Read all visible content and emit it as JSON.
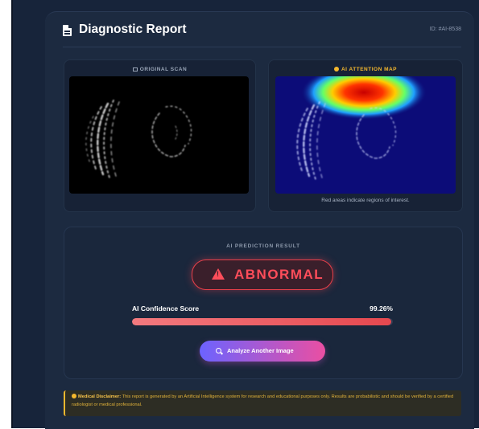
{
  "header": {
    "title": "Diagnostic Report",
    "report_id": "ID: #AI-8538"
  },
  "scan_panels": {
    "original_label": "ORIGINAL SCAN",
    "attention_label": "AI ATTENTION MAP",
    "attention_caption": "Red areas indicate regions of interest."
  },
  "result": {
    "heading": "AI PREDICTION RESULT",
    "prediction": "ABNORMAL",
    "confidence_label": "AI Confidence Score",
    "confidence_value": "99.26%",
    "confidence_fraction": 0.9926,
    "analyze_button": "Analyze Another Image"
  },
  "disclaimer": {
    "bold": "Medical Disclaimer:",
    "text": "This report is generated by an Artificial Intelligence system for research and educational purposes only. Results are probabilistic and should be verified by a certified radiologist or medical professional."
  },
  "colors": {
    "abnormal": "#ff4d5a",
    "warning": "#f5b82e",
    "button_start": "#6c63ff",
    "button_end": "#ea4fa2"
  },
  "icons": [
    "document-icon",
    "image-icon",
    "attention-dot-icon",
    "warning-triangle-icon",
    "search-icon",
    "info-icon"
  ]
}
